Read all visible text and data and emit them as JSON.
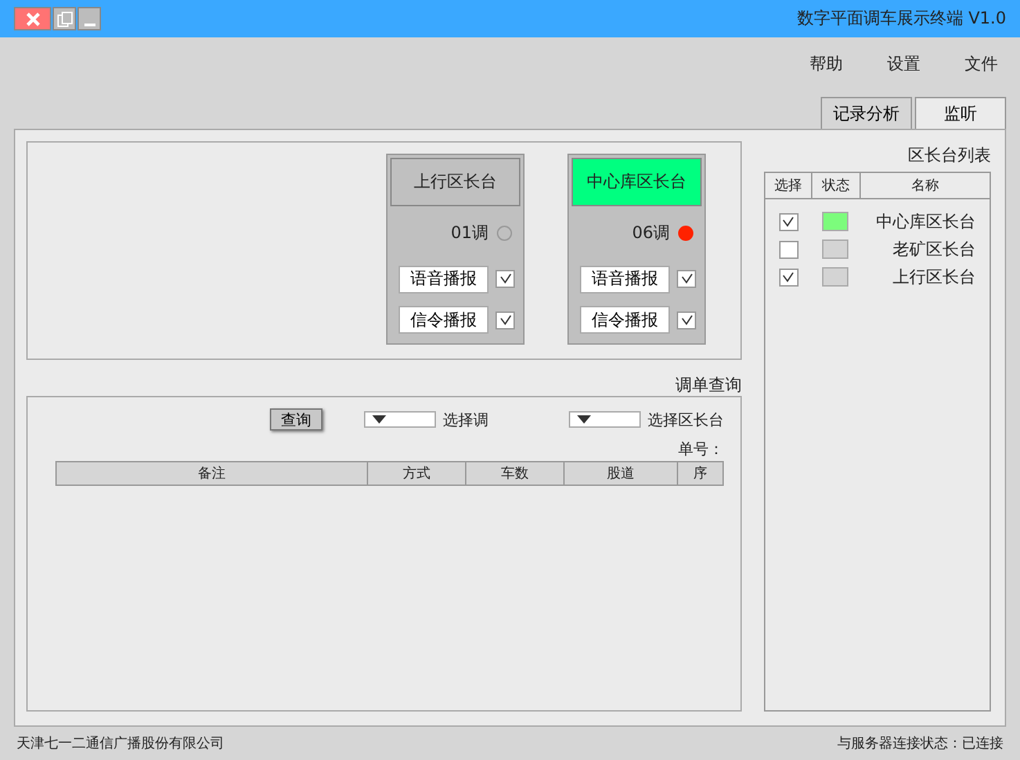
{
  "window": {
    "title": "数字平面调车展示终端  V1.0"
  },
  "menu": [
    "帮助",
    "设置",
    "文件"
  ],
  "tabs": [
    {
      "label": "记录分析",
      "selected": false
    },
    {
      "label": "监听",
      "selected": true
    }
  ],
  "station_list": {
    "title": "区长台列表",
    "columns": [
      "选择",
      "状态",
      "名称"
    ],
    "rows": [
      {
        "name": "中心库区长台",
        "color": "#7cfc7c",
        "checked": true
      },
      {
        "name": "老矿区长台",
        "color": "#d4d4d4",
        "checked": false
      },
      {
        "name": "上行区长台",
        "color": "#d4d4d4",
        "checked": true
      }
    ]
  },
  "cards": [
    {
      "title": "上行区长台",
      "active": false,
      "status_on": false,
      "shift": "01调",
      "voice_checked": true,
      "voice_label": "语音播报",
      "signal_checked": true,
      "signal_label": "信令播报"
    },
    {
      "title": "中心库区长台",
      "active": true,
      "status_on": true,
      "shift": "06调",
      "voice_checked": true,
      "voice_label": "语音播报",
      "signal_checked": true,
      "signal_label": "信令播报"
    }
  ],
  "query": {
    "title": "调单查询",
    "station_label": "选择区长台",
    "shift_label": "选择调",
    "button": "查询",
    "order_label": "单号：",
    "columns": [
      "备注",
      "方式",
      "车数",
      "股道",
      "序"
    ]
  },
  "status_bar": {
    "connection": "与服务器连接状态：已连接",
    "company": "天津七一二通信广播股份有限公司"
  }
}
